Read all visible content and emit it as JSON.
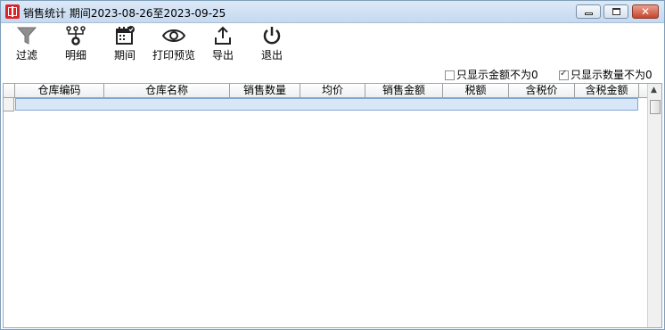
{
  "window": {
    "title": "销售统计 期间2023-08-26至2023-09-25",
    "controls": {
      "minimize": "minimize-icon",
      "maximize": "maximize-icon",
      "close": "✕"
    }
  },
  "toolbar": {
    "filter": {
      "label": "过滤",
      "icon": "filter-icon"
    },
    "detail": {
      "label": "明细",
      "icon": "detail-tree-icon"
    },
    "period": {
      "label": "期间",
      "icon": "calendar-icon"
    },
    "print_preview": {
      "label": "打印预览",
      "icon": "eye-icon"
    },
    "export": {
      "label": "导出",
      "icon": "export-icon"
    },
    "exit": {
      "label": "退出",
      "icon": "power-icon"
    }
  },
  "options": {
    "nonzero_amount": {
      "label": "只显示金额不为0",
      "checked": false
    },
    "nonzero_qty": {
      "label": "只显示数量不为0",
      "checked": true
    }
  },
  "grid": {
    "columns": [
      "仓库编码",
      "仓库名称",
      "销售数量",
      "均价",
      "销售金额",
      "税额",
      "含税价",
      "含税金额"
    ],
    "rows": []
  }
}
